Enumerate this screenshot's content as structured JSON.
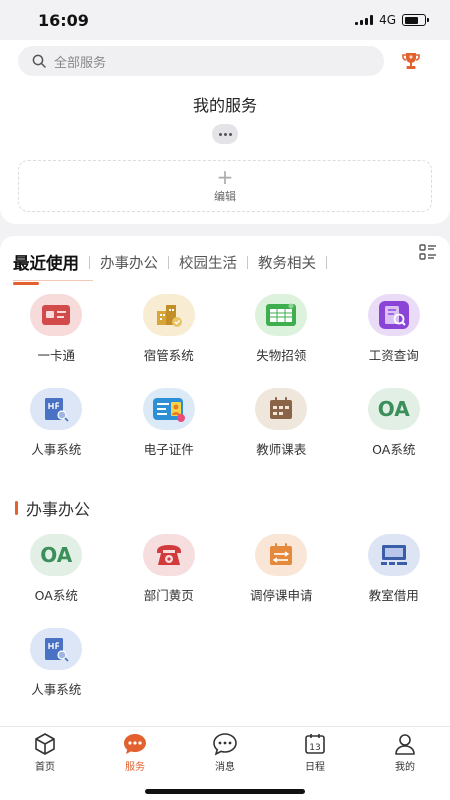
{
  "status": {
    "time": "16:09",
    "network": "4G",
    "battery_level": 0.7
  },
  "search": {
    "placeholder": "全部服务"
  },
  "my_services": {
    "title": "我的服务",
    "edit_label": "编辑"
  },
  "tabs": [
    {
      "label": "最近使用",
      "active": true
    },
    {
      "label": "办事办公"
    },
    {
      "label": "校园生活"
    },
    {
      "label": "教务相关"
    }
  ],
  "recent": [
    {
      "label": "一卡通",
      "icon": "id-card-icon"
    },
    {
      "label": "宿管系统",
      "icon": "dormitory-icon"
    },
    {
      "label": "失物招领",
      "icon": "lost-found-icon"
    },
    {
      "label": "工资查询",
      "icon": "salary-search-icon"
    },
    {
      "label": "人事系统",
      "icon": "hr-system-icon"
    },
    {
      "label": "电子证件",
      "icon": "e-certificate-icon"
    },
    {
      "label": "教师课表",
      "icon": "teacher-schedule-icon"
    },
    {
      "label": "OA系统",
      "icon": "oa-icon",
      "icon_text": "OA"
    }
  ],
  "section_office": {
    "title": "办事办公",
    "items": [
      {
        "label": "OA系统",
        "icon": "oa-icon",
        "icon_text": "OA"
      },
      {
        "label": "部门黄页",
        "icon": "phone-icon"
      },
      {
        "label": "调停课申请",
        "icon": "class-adjust-icon"
      },
      {
        "label": "教室借用",
        "icon": "classroom-borrow-icon"
      },
      {
        "label": "人事系统",
        "icon": "hr-system-icon"
      }
    ]
  },
  "bottom_nav": [
    {
      "label": "首页",
      "icon": "home-cube-icon"
    },
    {
      "label": "服务",
      "icon": "service-icon",
      "active": true
    },
    {
      "label": "消息",
      "icon": "message-icon"
    },
    {
      "label": "日程",
      "icon": "calendar-icon",
      "icon_text": "13"
    },
    {
      "label": "我的",
      "icon": "profile-icon"
    }
  ],
  "colors": {
    "accent": "#e2612f",
    "oa_green": "#3b8f5a"
  }
}
